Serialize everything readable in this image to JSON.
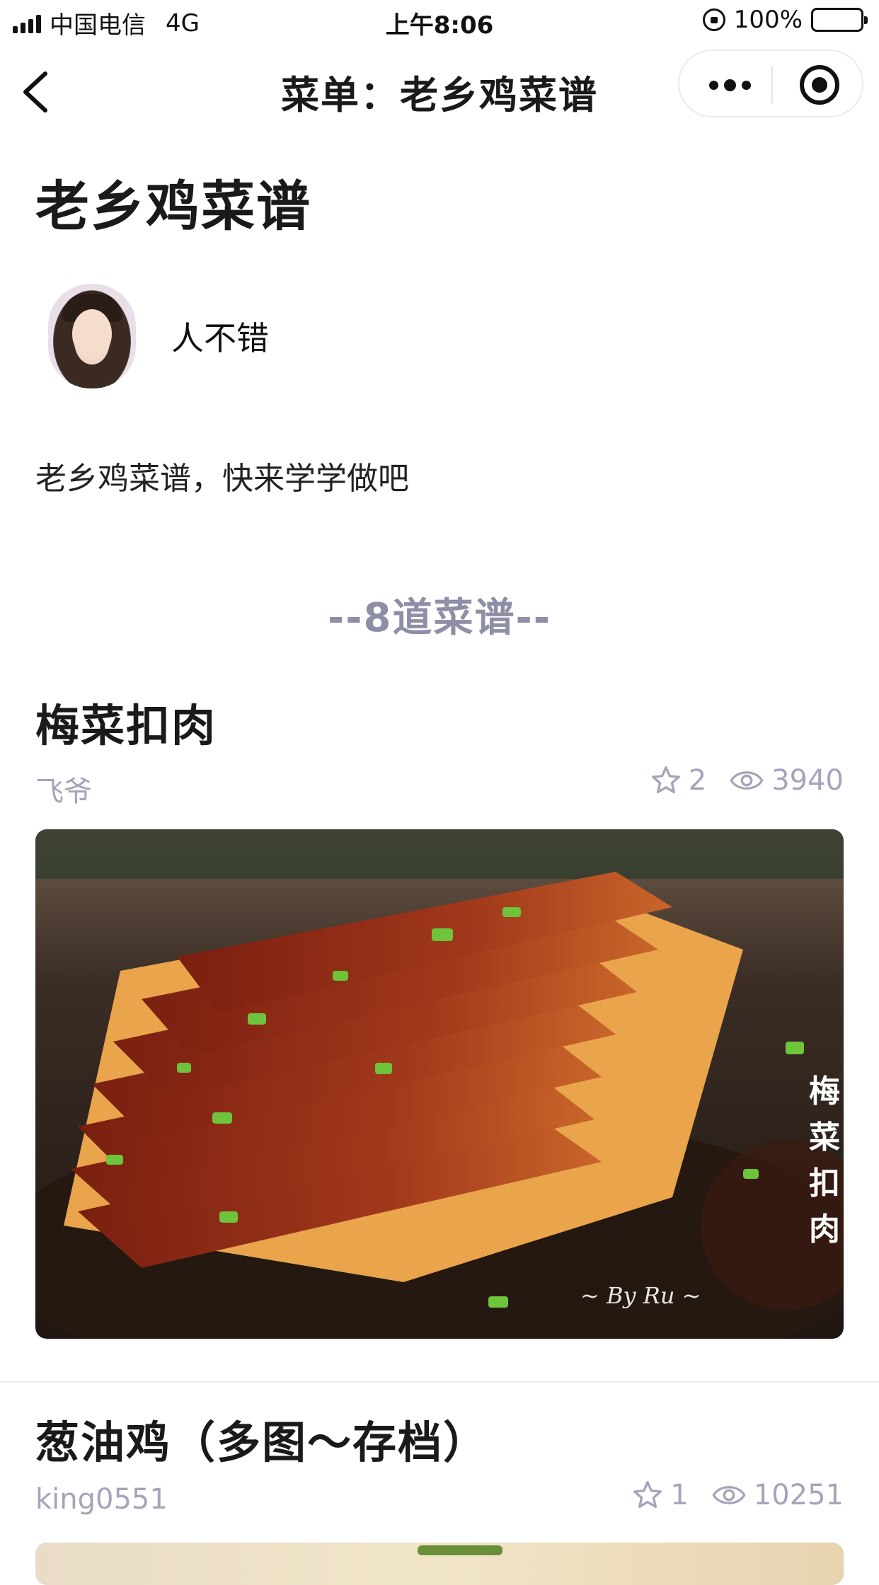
{
  "status_bar": {
    "carrier": "中国电信",
    "network": "4G",
    "time": "上午8:06",
    "battery": "100%"
  },
  "nav": {
    "title": "菜单：老乡鸡菜谱"
  },
  "menu": {
    "title": "老乡鸡菜谱",
    "author": "人不错",
    "description": "老乡鸡菜谱，快来学学做吧",
    "count_label": "--8道菜谱--"
  },
  "recipes": [
    {
      "title": "梅菜扣肉",
      "author": "飞爷",
      "stars": "2",
      "views": "3940",
      "image_caption": "梅菜扣肉",
      "image_signature": "~ By Ru ~"
    },
    {
      "title": "葱油鸡（多图～存档）",
      "author": "king0551",
      "stars": "1",
      "views": "10251"
    }
  ]
}
